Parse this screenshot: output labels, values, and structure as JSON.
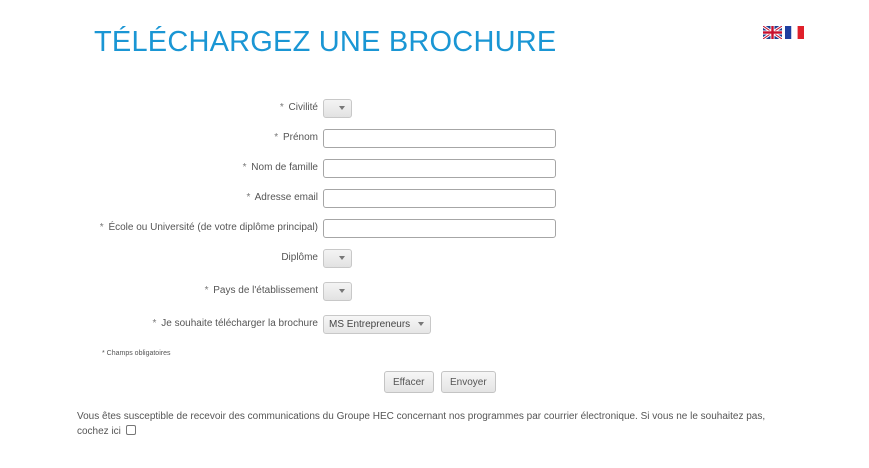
{
  "page": {
    "title": "TÉLÉCHARGEZ UNE BROCHURE"
  },
  "languages": [
    {
      "name": "English",
      "icon": "uk-flag-icon"
    },
    {
      "name": "Français",
      "icon": "france-flag-icon"
    }
  ],
  "form": {
    "required_mark": "*",
    "fields": {
      "civilite": {
        "label": "Civilité",
        "value": ""
      },
      "prenom": {
        "label": "Prénom",
        "value": ""
      },
      "nom": {
        "label": "Nom de famille",
        "value": ""
      },
      "email": {
        "label": "Adresse email",
        "value": ""
      },
      "ecole": {
        "label": "École ou Université (de votre diplôme principal)",
        "value": ""
      },
      "diplome": {
        "label": "Diplôme",
        "value": ""
      },
      "pays": {
        "label": "Pays de l'établissement",
        "value": ""
      },
      "brochure": {
        "label": "Je souhaite télécharger la brochure",
        "value": "MS Entrepreneurs"
      }
    },
    "required_note": "* Champs obligatoires",
    "buttons": {
      "reset": "Effacer",
      "submit": "Envoyer"
    },
    "consent_text": "Vous êtes susceptible de recevoir des communications du Groupe HEC concernant nos programmes par courrier électronique. Si vous ne le souhaitez pas, cochez ici",
    "consent_checked": false
  },
  "colors": {
    "title": "#1a96d4",
    "text": "#555555"
  }
}
